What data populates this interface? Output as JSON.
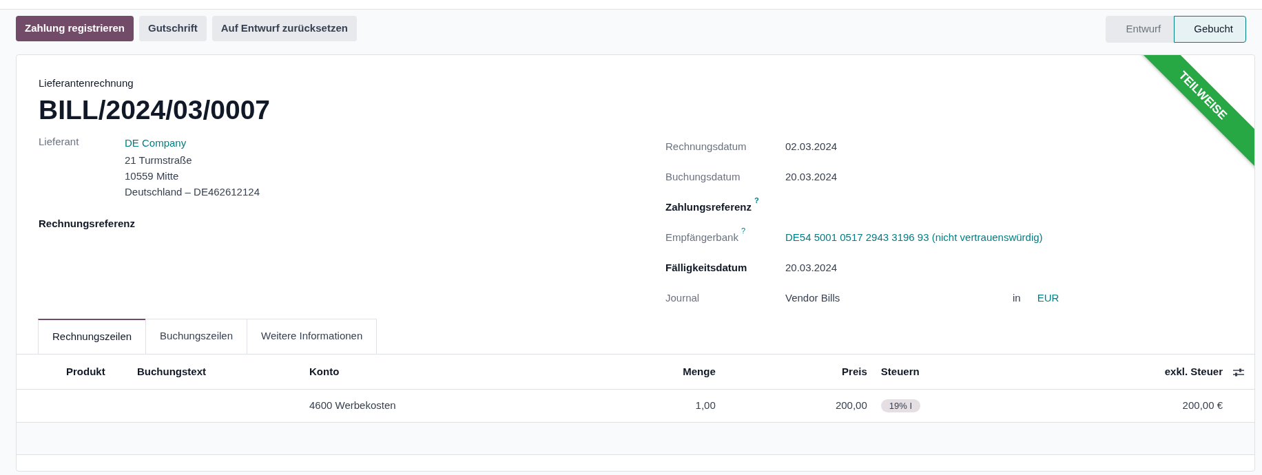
{
  "actions": [
    {
      "label": "Zahlung registrieren",
      "primary": true
    },
    {
      "label": "Gutschrift",
      "primary": false
    },
    {
      "label": "Auf Entwurf zurücksetzen",
      "primary": false
    }
  ],
  "status_steps": [
    {
      "label": "Entwurf",
      "selected": false
    },
    {
      "label": "Gebucht",
      "selected": true
    }
  ],
  "ribbon": "TEILWEISE",
  "form": {
    "doc_type": "Lieferantenrechnung",
    "title": "BILL/2024/03/0007",
    "left_fields": [
      {
        "label": "Lieferant",
        "bold": false,
        "link": "DE Company",
        "lines": [
          "21 Turmstraße",
          "10559 Mitte",
          "Deutschland – DE462612124"
        ]
      },
      {
        "label": "Rechnungsreferenz",
        "bold": true
      }
    ],
    "right_fields": [
      {
        "label": "Rechnungsdatum",
        "bold": false,
        "value": "02.03.2024",
        "link": false
      },
      {
        "label": "Buchungsdatum",
        "bold": false,
        "value": "20.03.2024",
        "link": false
      },
      {
        "label": "Zahlungsreferenz",
        "bold": true,
        "help_mark": "?"
      },
      {
        "label": "Empfängerbank",
        "bold": false,
        "help_mark": "?",
        "value": "DE54 5001 0517 2943 3196 93 (nicht vertrauenswürdig)",
        "link": true
      },
      {
        "label": "Fälligkeitsdatum",
        "bold": true,
        "value": "20.03.2024",
        "link": false
      },
      {
        "label": "Journal",
        "bold": false,
        "value": "Vendor Bills",
        "link": false,
        "suffix": "in",
        "currency": "EUR"
      }
    ]
  },
  "tabs": [
    {
      "label": "Rechnungszeilen",
      "selected": true
    },
    {
      "label": "Buchungszeilen",
      "selected": false
    },
    {
      "label": "Weitere Informationen",
      "selected": false
    }
  ],
  "table": {
    "columns": [
      {
        "label": "Produkt"
      },
      {
        "label": "Buchungstext"
      },
      {
        "label": "Konto"
      },
      {
        "label": "Menge"
      },
      {
        "label": "Preis"
      },
      {
        "label": "Steuern"
      },
      {
        "label": "exkl. Steuer"
      }
    ],
    "rows": [
      {
        "cells": [
          "",
          "",
          "4600 Werbekosten",
          "1,00",
          "200,00",
          {
            "tag": "19% I"
          },
          "200,00 €"
        ]
      }
    ]
  }
}
